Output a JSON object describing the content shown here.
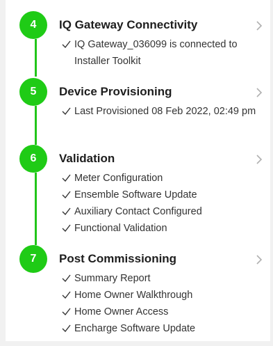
{
  "colors": {
    "accent": "#1fcb16",
    "title": "#1e1e1e",
    "text": "#333333",
    "chevron": "#b0b0b0"
  },
  "steps": [
    {
      "number": "4",
      "title": "IQ Gateway Connectivity",
      "items": [
        "IQ Gateway_036099 is connected to Installer Toolkit"
      ]
    },
    {
      "number": "5",
      "title": "Device Provisioning",
      "items": [
        "Last Provisioned 08 Feb 2022, 02:49 pm"
      ]
    },
    {
      "number": "6",
      "title": "Validation",
      "items": [
        "Meter Configuration",
        "Ensemble Software Update",
        "Auxiliary Contact Configured",
        "Functional Validation"
      ]
    },
    {
      "number": "7",
      "title": "Post Commissioning",
      "items": [
        "Summary Report",
        "Home Owner Walkthrough",
        "Home Owner Access",
        "Encharge Software Update"
      ]
    }
  ]
}
